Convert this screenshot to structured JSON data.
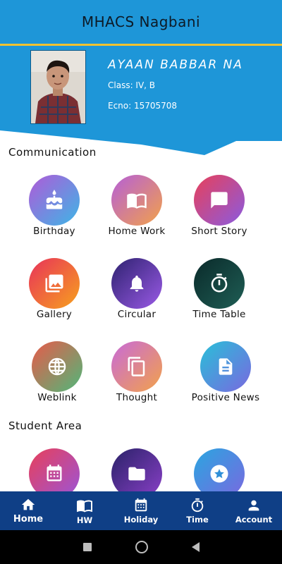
{
  "app": {
    "title": "MHACS Nagbani"
  },
  "colors": {
    "header": "#1e96d8",
    "accent_line": "#f2c230",
    "nav_bg": "#0f3f86"
  },
  "profile": {
    "name": "AYAAN  BABBAR NA",
    "class_text": "Class: IV, B",
    "ecno_text": "Ecno: 15705708"
  },
  "communication": {
    "title": "Communication",
    "items": [
      {
        "label": "Birthday",
        "icon": "cake-icon"
      },
      {
        "label": "Home Work",
        "icon": "book-icon"
      },
      {
        "label": "Short Story",
        "icon": "chat-icon"
      },
      {
        "label": "Gallery",
        "icon": "photo-library-icon"
      },
      {
        "label": "Circular",
        "icon": "bell-icon"
      },
      {
        "label": "Time Table",
        "icon": "stopwatch-icon"
      },
      {
        "label": "Weblink",
        "icon": "globe-icon"
      },
      {
        "label": "Thought",
        "icon": "copy-icon"
      },
      {
        "label": "Positive News",
        "icon": "document-icon"
      }
    ]
  },
  "student_area": {
    "title": "Student Area",
    "items": [
      {
        "icon": "calendar-icon"
      },
      {
        "icon": "folder-icon"
      },
      {
        "icon": "star-badge-icon"
      }
    ]
  },
  "bottom_nav": {
    "items": [
      {
        "label": "Home",
        "icon": "home-icon",
        "active": true
      },
      {
        "label": "HW",
        "icon": "book-icon"
      },
      {
        "label": "Holiday",
        "icon": "calendar-icon"
      },
      {
        "label": "Time",
        "icon": "stopwatch-icon"
      },
      {
        "label": "Account",
        "icon": "person-icon"
      }
    ]
  },
  "system_nav": {
    "items": [
      "recents-button",
      "home-button",
      "back-button"
    ]
  }
}
